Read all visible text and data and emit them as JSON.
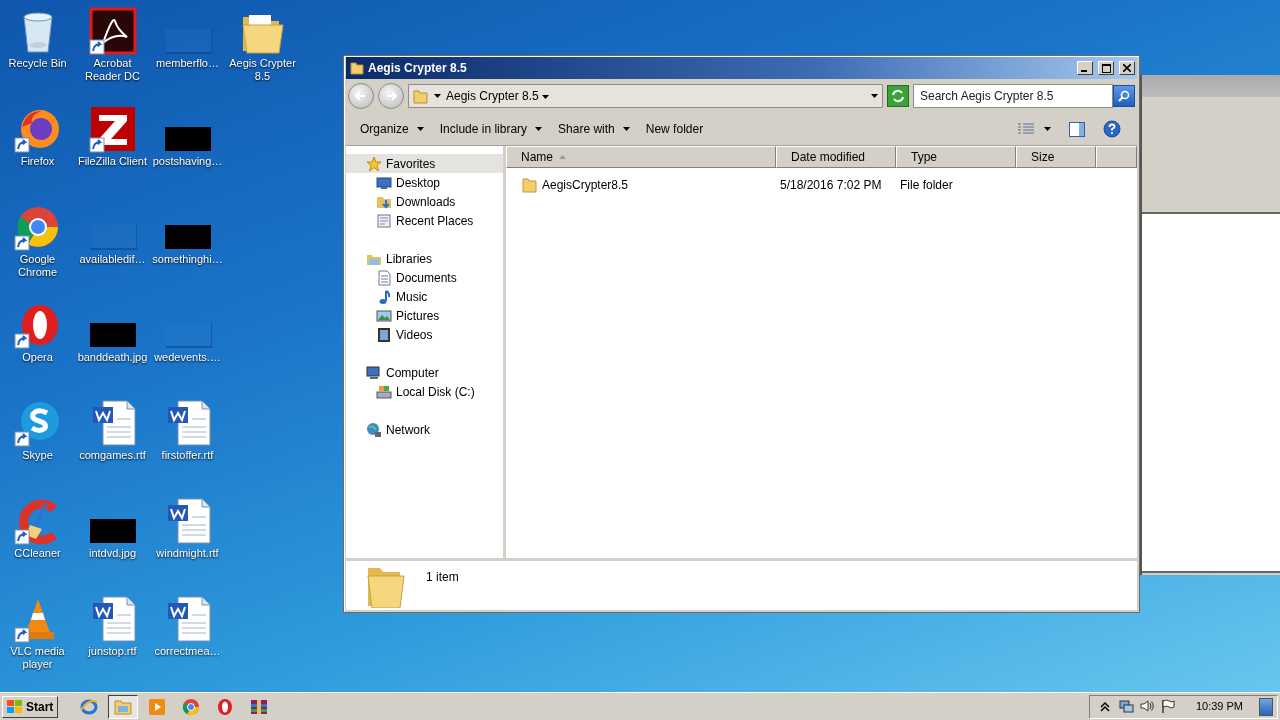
{
  "desktop_icons": [
    [
      {
        "label": "Recycle Bin",
        "kind": "recycle",
        "shortcut": false
      },
      {
        "label": "Firefox",
        "kind": "firefox",
        "shortcut": true
      },
      {
        "label": "Google Chrome",
        "kind": "chrome",
        "shortcut": true
      },
      {
        "label": "Opera",
        "kind": "opera",
        "shortcut": true
      },
      {
        "label": "Skype",
        "kind": "skype",
        "shortcut": true
      },
      {
        "label": "CCleaner",
        "kind": "ccleaner",
        "shortcut": true
      },
      {
        "label": "VLC media player",
        "kind": "vlc",
        "shortcut": true
      }
    ],
    [
      {
        "label": "Acrobat Reader DC",
        "kind": "acrobat",
        "shortcut": true
      },
      {
        "label": "FileZilla Client",
        "kind": "filezilla",
        "shortcut": true
      },
      {
        "label": "availabledif…",
        "kind": "blank",
        "shortcut": false
      },
      {
        "label": "banddeath.jpg",
        "kind": "dark-image",
        "shortcut": false
      },
      {
        "label": "comgames.rtf",
        "kind": "word",
        "shortcut": false
      },
      {
        "label": "intdvd.jpg",
        "kind": "dark-image",
        "shortcut": false
      },
      {
        "label": "junstop.rtf",
        "kind": "word",
        "shortcut": false
      }
    ],
    [
      {
        "label": "memberflo…",
        "kind": "blank",
        "shortcut": false
      },
      {
        "label": "postshaving…",
        "kind": "dark-image",
        "shortcut": false
      },
      {
        "label": "somethinghi…",
        "kind": "dark-image",
        "shortcut": false
      },
      {
        "label": "wedevents.…",
        "kind": "blank",
        "shortcut": false
      },
      {
        "label": "firstoffer.rtf",
        "kind": "word",
        "shortcut": false
      },
      {
        "label": "windmight.rtf",
        "kind": "word",
        "shortcut": false
      },
      {
        "label": "correctmea…",
        "kind": "word",
        "shortcut": false
      }
    ],
    [
      {
        "label": "Aegis Crypter 8.5",
        "kind": "folder",
        "shortcut": false
      }
    ]
  ],
  "window": {
    "title": "Aegis Crypter 8.5",
    "breadcrumb": "Aegis Crypter 8.5",
    "search": {
      "placeholder": "Search Aegis Crypter 8.5"
    },
    "toolbar": [
      {
        "label": "Organize",
        "dropdown": true
      },
      {
        "label": "Include in library",
        "dropdown": true
      },
      {
        "label": "Share with",
        "dropdown": true
      },
      {
        "label": "New folder",
        "dropdown": false
      }
    ],
    "nav": [
      {
        "label": "Favorites",
        "kind": "star",
        "selected": true,
        "children": [
          {
            "label": "Desktop",
            "kind": "desktop",
            "selected": false
          },
          {
            "label": "Downloads",
            "kind": "downloads",
            "selected": false
          },
          {
            "label": "Recent Places",
            "kind": "recent",
            "selected": false
          }
        ]
      },
      {
        "label": "Libraries",
        "kind": "library",
        "selected": false,
        "children": [
          {
            "label": "Documents",
            "kind": "documents",
            "selected": false
          },
          {
            "label": "Music",
            "kind": "music",
            "selected": false
          },
          {
            "label": "Pictures",
            "kind": "pictures",
            "selected": false
          },
          {
            "label": "Videos",
            "kind": "videos",
            "selected": false
          }
        ]
      },
      {
        "label": "Computer",
        "kind": "computer",
        "selected": false,
        "children": [
          {
            "label": "Local Disk (C:)",
            "kind": "disk",
            "selected": false
          }
        ]
      },
      {
        "label": "Network",
        "kind": "network",
        "selected": false
      }
    ],
    "columns": [
      {
        "label": "Name",
        "sorted": true
      },
      {
        "label": "Date modified",
        "sorted": false
      },
      {
        "label": "Type",
        "sorted": false
      },
      {
        "label": "Size",
        "sorted": false
      }
    ],
    "rows": [
      {
        "name": "AegisCrypter8.5",
        "date_modified": "5/18/2016 7:02 PM",
        "type": "File folder"
      }
    ],
    "details": "1 item"
  },
  "taskbar": {
    "start": "Start",
    "pinned": [
      {
        "kind": "ie",
        "active": false
      },
      {
        "kind": "explorer",
        "active": true
      },
      {
        "kind": "media",
        "active": false
      },
      {
        "kind": "chrome",
        "active": false
      },
      {
        "kind": "opera",
        "active": false
      },
      {
        "kind": "winrar",
        "active": false
      }
    ],
    "tray": [
      {
        "kind": "chevron"
      },
      {
        "kind": "network"
      },
      {
        "kind": "speaker"
      },
      {
        "kind": "flag"
      }
    ],
    "time": "10:39 PM"
  }
}
